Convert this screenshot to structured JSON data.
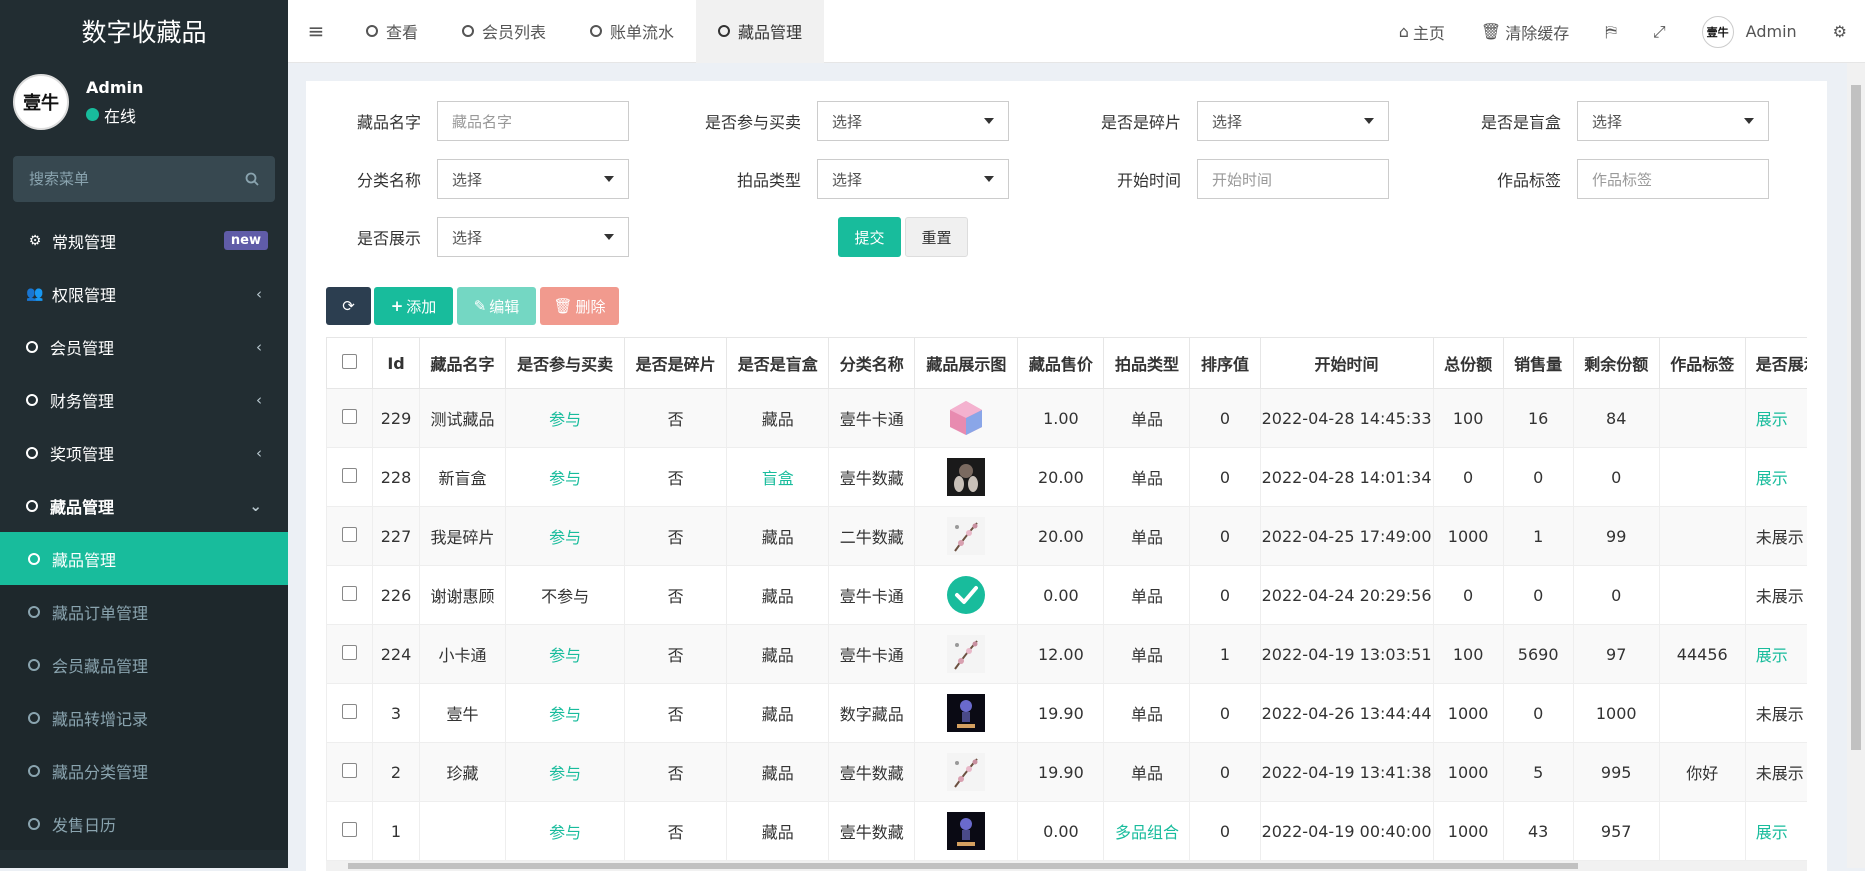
{
  "sidebar": {
    "brand": "数字收藏品",
    "user": {
      "name": "Admin",
      "status": "在线"
    },
    "search_placeholder": "搜索菜单",
    "badge_new": "new",
    "menu": [
      {
        "label": "常规管理"
      },
      {
        "label": "权限管理"
      },
      {
        "label": "会员管理"
      },
      {
        "label": "财务管理"
      },
      {
        "label": "奖项管理"
      },
      {
        "label": "藏品管理"
      }
    ],
    "submenu": [
      {
        "label": "藏品管理"
      },
      {
        "label": "藏品订单管理"
      },
      {
        "label": "会员藏品管理"
      },
      {
        "label": "藏品转增记录"
      },
      {
        "label": "藏品分类管理"
      },
      {
        "label": "发售日历"
      }
    ]
  },
  "topbar": {
    "tabs": [
      "查看",
      "会员列表",
      "账单流水",
      "藏品管理"
    ],
    "home": "主页",
    "clear_cache": "清除缓存",
    "admin": "Admin"
  },
  "filters": {
    "name_label": "藏品名字",
    "name_placeholder": "藏品名字",
    "trade_label": "是否参与买卖",
    "fragment_label": "是否是碎片",
    "blindbox_label": "是否是盲盒",
    "category_label": "分类名称",
    "auction_label": "拍品类型",
    "start_label": "开始时间",
    "start_placeholder": "开始时间",
    "tag_label": "作品标签",
    "tag_placeholder": "作品标签",
    "display_label": "是否展示",
    "select_text": "选择",
    "submit": "提交",
    "reset": "重置"
  },
  "toolbar": {
    "add": "添加",
    "edit": "编辑",
    "delete": "删除"
  },
  "table": {
    "headers": [
      "Id",
      "藏品名字",
      "是否参与买卖",
      "是否是碎片",
      "是否是盲盒",
      "分类名称",
      "藏品展示图",
      "藏品售价",
      "拍品类型",
      "排序值",
      "开始时间",
      "总份额",
      "销售量",
      "剩余份额",
      "作品标签",
      "是否展示"
    ],
    "rows": [
      {
        "id": "229",
        "name": "测试藏品",
        "trade": "参与",
        "fragment": "否",
        "blind": "藏品",
        "cat": "壹牛卡通",
        "img": "cube",
        "price": "1.00",
        "type": "单品",
        "sort": "0",
        "start": "2022-04-28 14:45:33",
        "total": "100",
        "sold": "16",
        "left": "84",
        "tag": "",
        "show": "展示"
      },
      {
        "id": "228",
        "name": "新盲盒",
        "trade": "参与",
        "fragment": "否",
        "blind": "盲盒",
        "cat": "壹牛数藏",
        "img": "dark",
        "price": "20.00",
        "type": "单品",
        "sort": "0",
        "start": "2022-04-28 14:01:34",
        "total": "0",
        "sold": "0",
        "left": "0",
        "tag": "",
        "show": "展示"
      },
      {
        "id": "227",
        "name": "我是碎片",
        "trade": "参与",
        "fragment": "否",
        "blind": "藏品",
        "cat": "二牛数藏",
        "img": "flower",
        "price": "20.00",
        "type": "单品",
        "sort": "0",
        "start": "2022-04-25 17:49:00",
        "total": "1000",
        "sold": "1",
        "left": "99",
        "tag": "",
        "show": "未展示"
      },
      {
        "id": "226",
        "name": "谢谢惠顾",
        "trade": "不参与",
        "fragment": "否",
        "blind": "藏品",
        "cat": "壹牛卡通",
        "img": "check",
        "price": "0.00",
        "type": "单品",
        "sort": "0",
        "start": "2022-04-24 20:29:56",
        "total": "0",
        "sold": "0",
        "left": "0",
        "tag": "",
        "show": "未展示"
      },
      {
        "id": "224",
        "name": "小卡通",
        "trade": "参与",
        "fragment": "否",
        "blind": "藏品",
        "cat": "壹牛卡通",
        "img": "flower",
        "price": "12.00",
        "type": "单品",
        "sort": "1",
        "start": "2022-04-19 13:03:51",
        "total": "100",
        "sold": "5690",
        "left": "97",
        "tag": "44456",
        "show": "展示"
      },
      {
        "id": "3",
        "name": "壹牛",
        "trade": "参与",
        "fragment": "否",
        "blind": "藏品",
        "cat": "数字藏品",
        "img": "figure",
        "price": "19.90",
        "type": "单品",
        "sort": "0",
        "start": "2022-04-26 13:44:44",
        "total": "1000",
        "sold": "0",
        "left": "1000",
        "tag": "",
        "show": "未展示"
      },
      {
        "id": "2",
        "name": "珍藏",
        "trade": "参与",
        "fragment": "否",
        "blind": "藏品",
        "cat": "壹牛数藏",
        "img": "flower",
        "price": "19.90",
        "type": "单品",
        "sort": "0",
        "start": "2022-04-19 13:41:38",
        "total": "1000",
        "sold": "5",
        "left": "995",
        "tag": "你好",
        "show": "未展示"
      },
      {
        "id": "1",
        "name": "",
        "trade": "参与",
        "fragment": "否",
        "blind": "藏品",
        "cat": "壹牛数藏",
        "img": "figure",
        "price": "0.00",
        "type": "多品组合",
        "sort": "0",
        "start": "2022-04-19 00:40:00",
        "total": "1000",
        "sold": "43",
        "left": "957",
        "tag": "",
        "show": "展示"
      }
    ]
  }
}
